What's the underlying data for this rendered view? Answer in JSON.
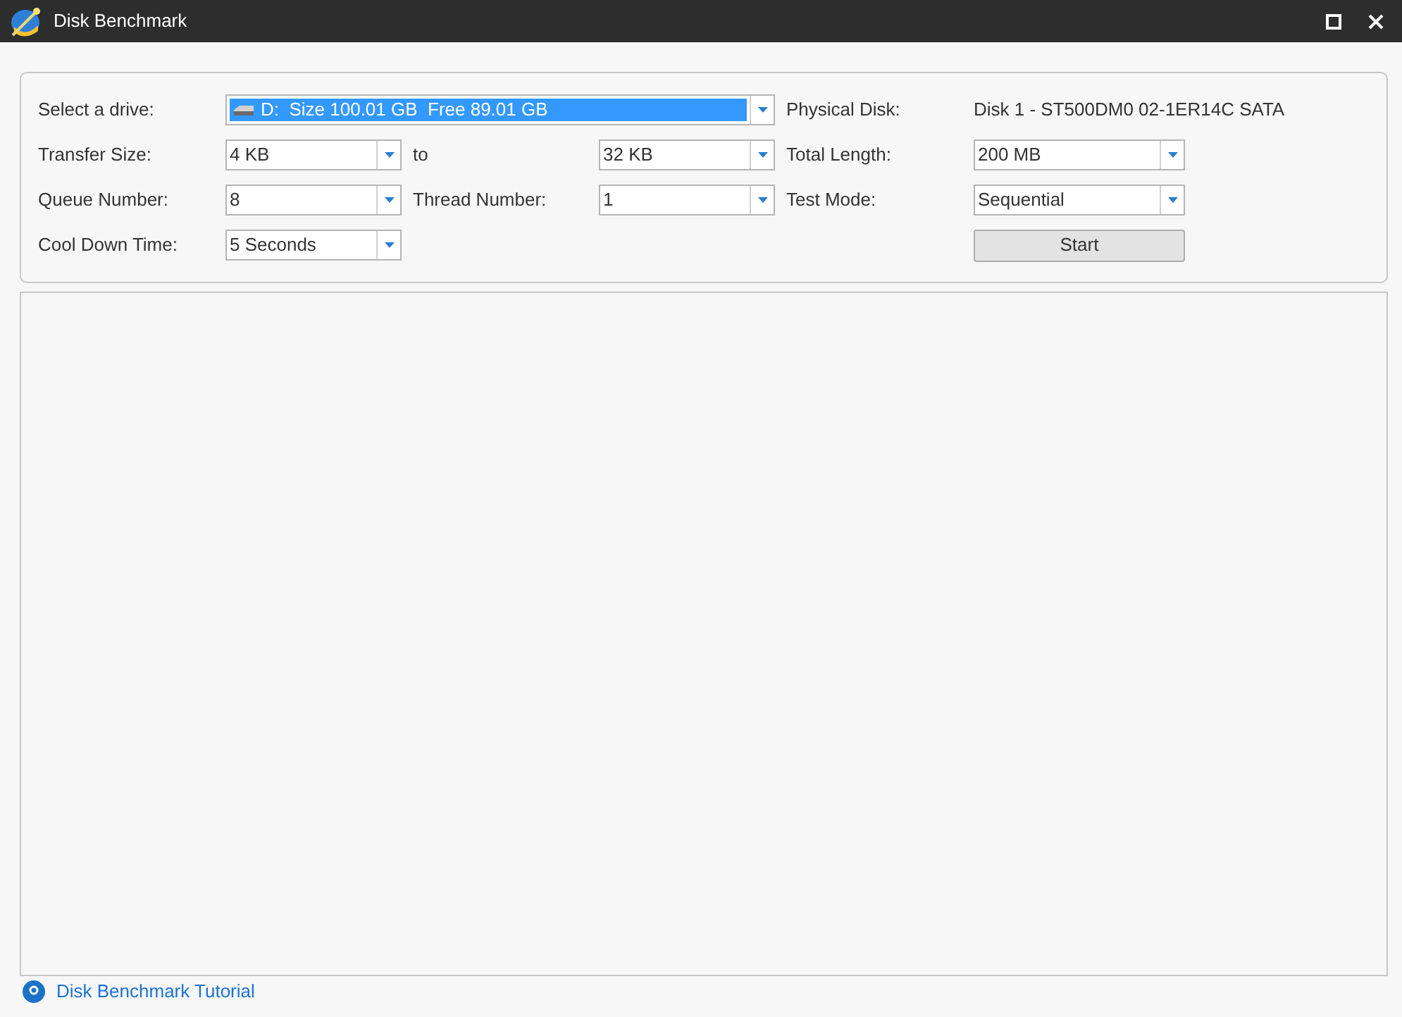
{
  "window": {
    "title": "Disk Benchmark"
  },
  "drive": {
    "label": "Select a drive:",
    "value": "D:  Size 100.01 GB  Free 89.01 GB",
    "highlighted": true
  },
  "physical_disk": {
    "label": "Physical Disk:",
    "value": "Disk 1 - ST500DM0 02-1ER14C SATA"
  },
  "transfer_size": {
    "label": "Transfer Size:",
    "from": "4 KB",
    "to_label": "to",
    "to": "32 KB"
  },
  "total_length": {
    "label": "Total Length:",
    "value": "200 MB"
  },
  "queue_number": {
    "label": "Queue Number:",
    "value": "8"
  },
  "thread_number": {
    "label": "Thread Number:",
    "value": "1"
  },
  "test_mode": {
    "label": "Test Mode:",
    "value": "Sequential"
  },
  "cool_down_time": {
    "label": "Cool Down Time:",
    "value": "5 Seconds"
  },
  "start_button": {
    "label": "Start"
  },
  "tutorial_link": {
    "label": "Disk Benchmark Tutorial"
  }
}
